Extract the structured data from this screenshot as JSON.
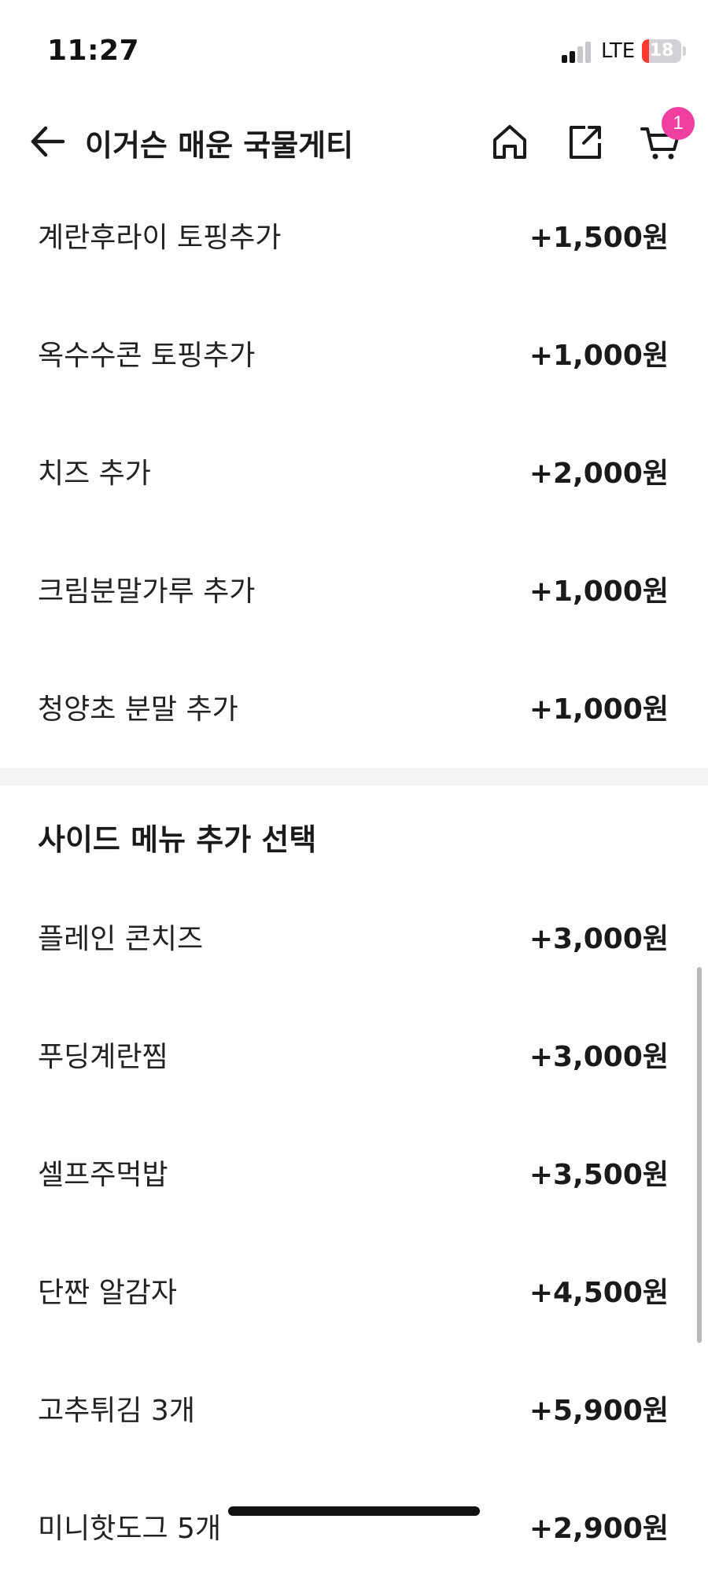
{
  "status_bar": {
    "time": "11:27",
    "network": "LTE",
    "battery": "18",
    "battery_color": "#ff3b30"
  },
  "header": {
    "title": "이거슨 매운 국물게티",
    "cart_count": "1",
    "badge_color": "#f03fa0",
    "icons": [
      "back-arrow-icon",
      "home-icon",
      "share-icon",
      "cart-icon"
    ]
  },
  "topping_options": [
    {
      "label": "계란후라이 토핑추가",
      "price": "+1,500원"
    },
    {
      "label": "옥수수콘 토핑추가",
      "price": "+1,000원"
    },
    {
      "label": "치즈 추가",
      "price": "+2,000원"
    },
    {
      "label": "크림분말가루 추가",
      "price": "+1,000원"
    },
    {
      "label": "청양초 분말 추가",
      "price": "+1,000원"
    }
  ],
  "side_section": {
    "title": "사이드 메뉴 추가 선택",
    "options": [
      {
        "label": "플레인 콘치즈",
        "price": "+3,000원"
      },
      {
        "label": "푸딩계란찜",
        "price": "+3,000원"
      },
      {
        "label": "셀프주먹밥",
        "price": "+3,500원"
      },
      {
        "label": "단짠 알감자",
        "price": "+4,500원"
      },
      {
        "label": "고추튀김 3개",
        "price": "+5,900원"
      },
      {
        "label": "미니핫도그 5개",
        "price": "+2,900원"
      }
    ]
  }
}
